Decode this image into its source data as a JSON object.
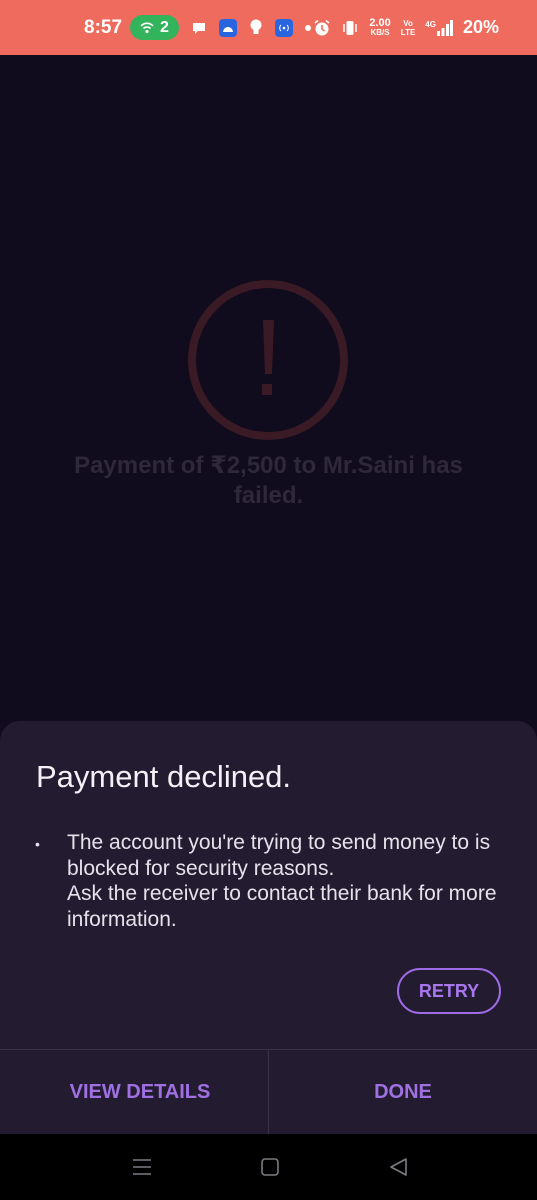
{
  "status_bar": {
    "time": "8:57",
    "hotspot_count": "2",
    "net_speed_value": "2.00",
    "net_speed_unit": "KB/S",
    "volte_top": "Vo",
    "volte_bottom": "LTE",
    "network_type": "4G",
    "battery": "20%",
    "icons": [
      "hotspot-icon",
      "chat-icon",
      "android-app-icon",
      "lightbulb-icon",
      "nfc-app-icon",
      "dot-icon",
      "alarm-icon",
      "vibrate-icon",
      "signal-icon"
    ]
  },
  "background": {
    "fail_message": "Payment of ₹2,500 to Mr.Saini has failed.",
    "icon": "exclamation-circle-icon"
  },
  "sheet": {
    "title": "Payment declined.",
    "bullet": "•",
    "body_line1": "The account you're trying to send money to is blocked for security reasons.",
    "body_line2": "Ask the receiver to contact their bank for more information.",
    "retry_label": "RETRY",
    "view_details_label": "VIEW DETAILS",
    "done_label": "DONE"
  },
  "nav_bar": {
    "icons": [
      "menu-icon",
      "home-icon",
      "back-icon"
    ]
  },
  "colors": {
    "status_bar": "#ee6b5d",
    "background": "#100b1d",
    "sheet": "#231c30",
    "accent": "#a070e3"
  }
}
